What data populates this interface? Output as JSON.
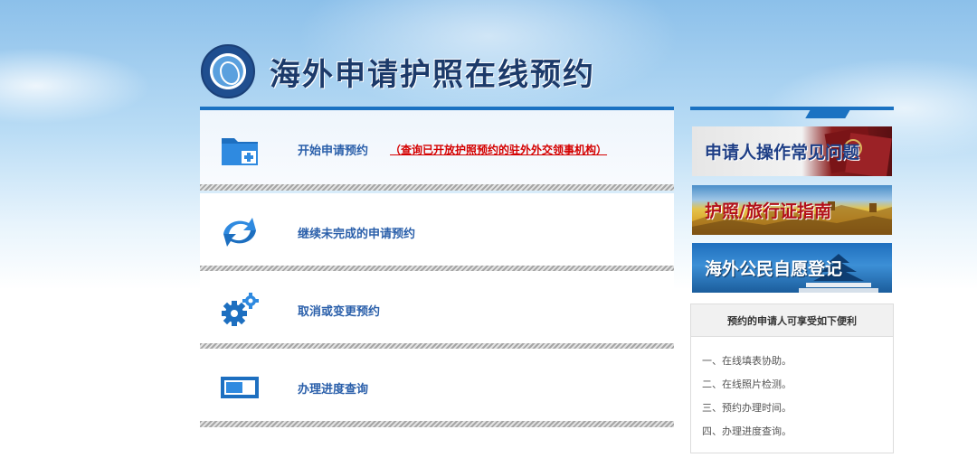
{
  "header": {
    "title": "海外申请护照在线预约",
    "emblem_icon": "consular-emblem-icon"
  },
  "menu": [
    {
      "label": "开始申请预约",
      "note": "（查询已开放护照预约的驻外外交领事机构）",
      "icon": "folder-plus-icon"
    },
    {
      "label": "继续未完成的申请预约",
      "icon": "refresh-arrows-icon"
    },
    {
      "label": "取消或变更预约",
      "icon": "gears-icon"
    },
    {
      "label": "办理进度查询",
      "icon": "progress-bar-icon"
    }
  ],
  "sidebar": {
    "banners": [
      {
        "label": "申请人操作常见问题"
      },
      {
        "label": "护照/旅行证指南"
      },
      {
        "label": "海外公民自愿登记"
      }
    ],
    "benefits_title": "预约的申请人可享受如下便利",
    "benefits": [
      "一、在线填表协助。",
      "二、在线照片检测。",
      "三、预约办理时间。",
      "四、办理进度查询。"
    ]
  },
  "colors": {
    "accent": "#1b72c2",
    "link": "#2a5faa",
    "note": "#d40000",
    "title": "#1c3a6a"
  }
}
